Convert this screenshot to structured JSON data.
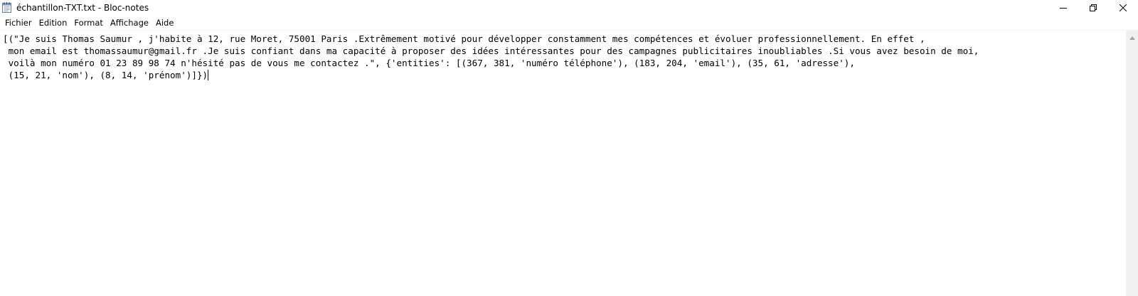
{
  "window": {
    "title": "échantillon-TXT.txt - Bloc-notes",
    "app_icon": "notepad-icon"
  },
  "controls": {
    "minimize_icon": "minimize-icon",
    "maximize_icon": "restore-icon",
    "close_icon": "close-icon"
  },
  "menu": {
    "items": [
      {
        "label": "Fichier"
      },
      {
        "label": "Edition"
      },
      {
        "label": "Format"
      },
      {
        "label": "Affichage"
      },
      {
        "label": "Aide"
      }
    ]
  },
  "editor": {
    "lines": [
      "[(\"Je suis Thomas Saumur , j'habite à 12, rue Moret, 75001 Paris .Extrêmement motivé pour développer constamment mes compétences et évoluer professionnellement. En effet ,",
      " mon email est thomassaumur@gmail.fr .Je suis confiant dans ma capacité à proposer des idées intéressantes pour des campagnes publicitaires inoubliables .Si vous avez besoin de moi,",
      " voilà mon numéro 01 23 89 98 74 n'hésité pas de vous me contactez .\", {'entities': [(367, 381, 'numéro téléphone'), (183, 204, 'email'), (35, 61, 'adresse'),",
      " (15, 21, 'nom'), (8, 14, 'prénom')]})"
    ]
  },
  "scrollbar": {
    "up_icon": "scroll-up-arrow-icon"
  }
}
